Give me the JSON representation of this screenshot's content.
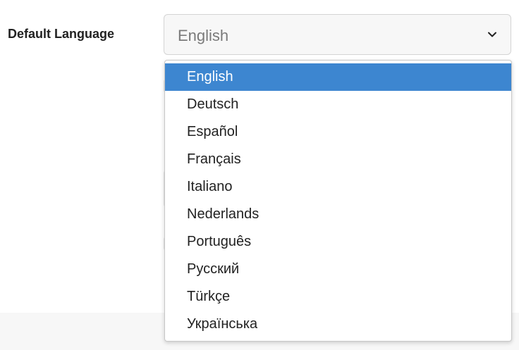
{
  "form": {
    "label": "Default Language",
    "select": {
      "value": "English"
    }
  },
  "dropdown": {
    "selected_index": 0,
    "options": [
      "English",
      "Deutsch",
      "Español",
      "Français",
      "Italiano",
      "Nederlands",
      "Português",
      "Русский",
      "Türkçe",
      "Українська"
    ]
  },
  "colors": {
    "highlight": "#3d86d0",
    "highlight_text": "#ffffff",
    "field_background": "#f7f7f7"
  },
  "icons": {
    "dropdown_toggle": "chevron-down-icon"
  }
}
